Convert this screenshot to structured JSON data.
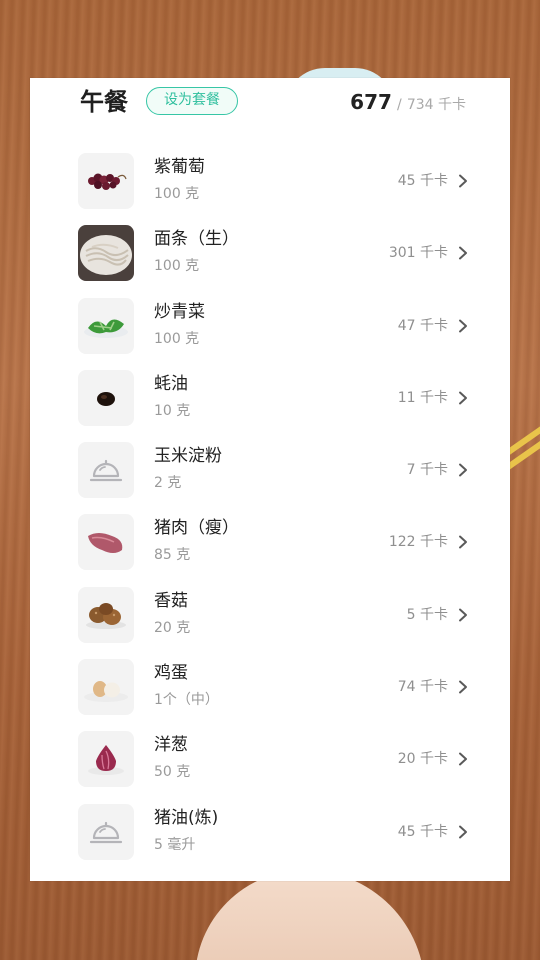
{
  "meal": {
    "title": "午餐",
    "set_meal_label": "设为套餐",
    "calories_eaten": "677",
    "calories_separator": "/",
    "calories_target": "734 千卡"
  },
  "items": [
    {
      "name": "紫葡萄",
      "amount": "100 克",
      "calories": "45 千卡",
      "icon": "grape"
    },
    {
      "name": "面条（生）",
      "amount": "100 克",
      "calories": "301 千卡",
      "icon": "noodle"
    },
    {
      "name": "炒青菜",
      "amount": "100 克",
      "calories": "47 千卡",
      "icon": "greens"
    },
    {
      "name": "蚝油",
      "amount": "10 克",
      "calories": "11 千卡",
      "icon": "oyster-sauce"
    },
    {
      "name": "玉米淀粉",
      "amount": "2 克",
      "calories": "7 千卡",
      "icon": "dish-placeholder"
    },
    {
      "name": "猪肉（瘦）",
      "amount": "85 克",
      "calories": "122 千卡",
      "icon": "pork"
    },
    {
      "name": "香菇",
      "amount": "20 克",
      "calories": "5 千卡",
      "icon": "mushroom"
    },
    {
      "name": "鸡蛋",
      "amount": "1个（中）",
      "calories": "74 千卡",
      "icon": "egg"
    },
    {
      "name": "洋葱",
      "amount": "50 克",
      "calories": "20 千卡",
      "icon": "onion"
    },
    {
      "name": "猪油(炼)",
      "amount": "5 毫升",
      "calories": "45 千卡",
      "icon": "dish-placeholder"
    }
  ],
  "colors": {
    "accent": "#37c6a6",
    "text_primary": "#222222",
    "text_secondary": "#9a9a9a"
  }
}
